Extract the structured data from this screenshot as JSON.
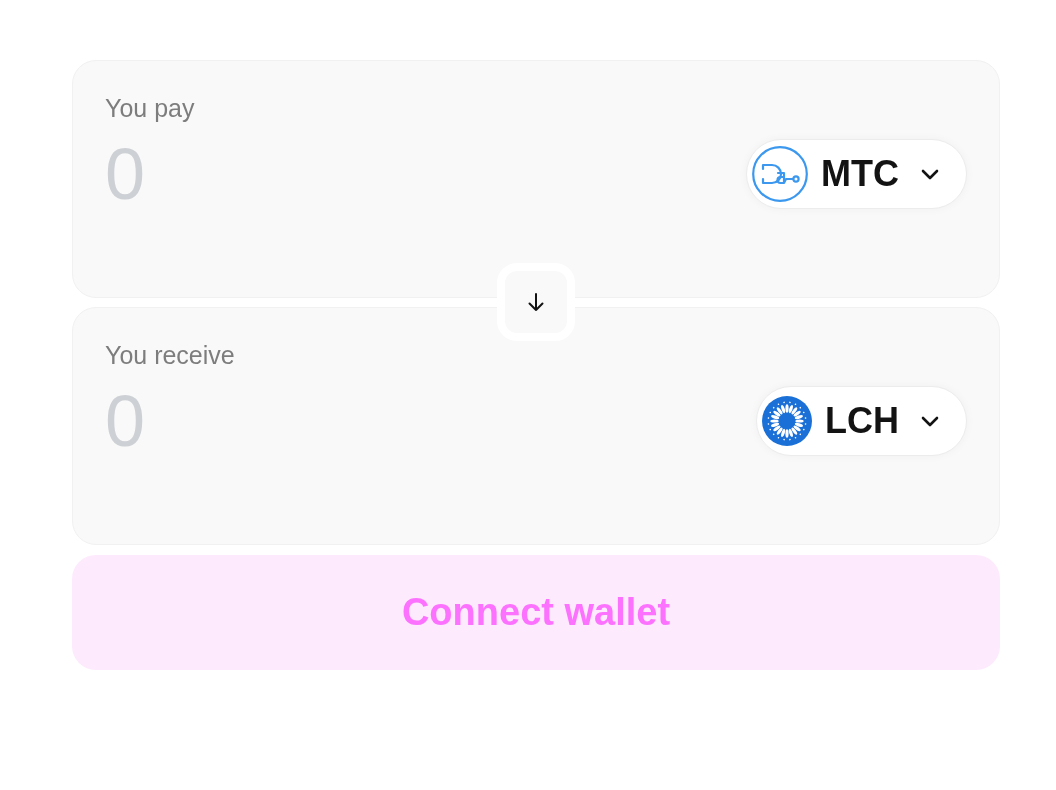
{
  "sections": [
    {
      "label": "You pay",
      "amount": {
        "placeholder": "0"
      },
      "token": {
        "symbol": "MTC"
      }
    },
    {
      "label": "You receive",
      "amount": {
        "placeholder": "0"
      },
      "token": {
        "symbol": "LCH"
      }
    }
  ],
  "connect_button": {
    "label": "Connect wallet"
  }
}
